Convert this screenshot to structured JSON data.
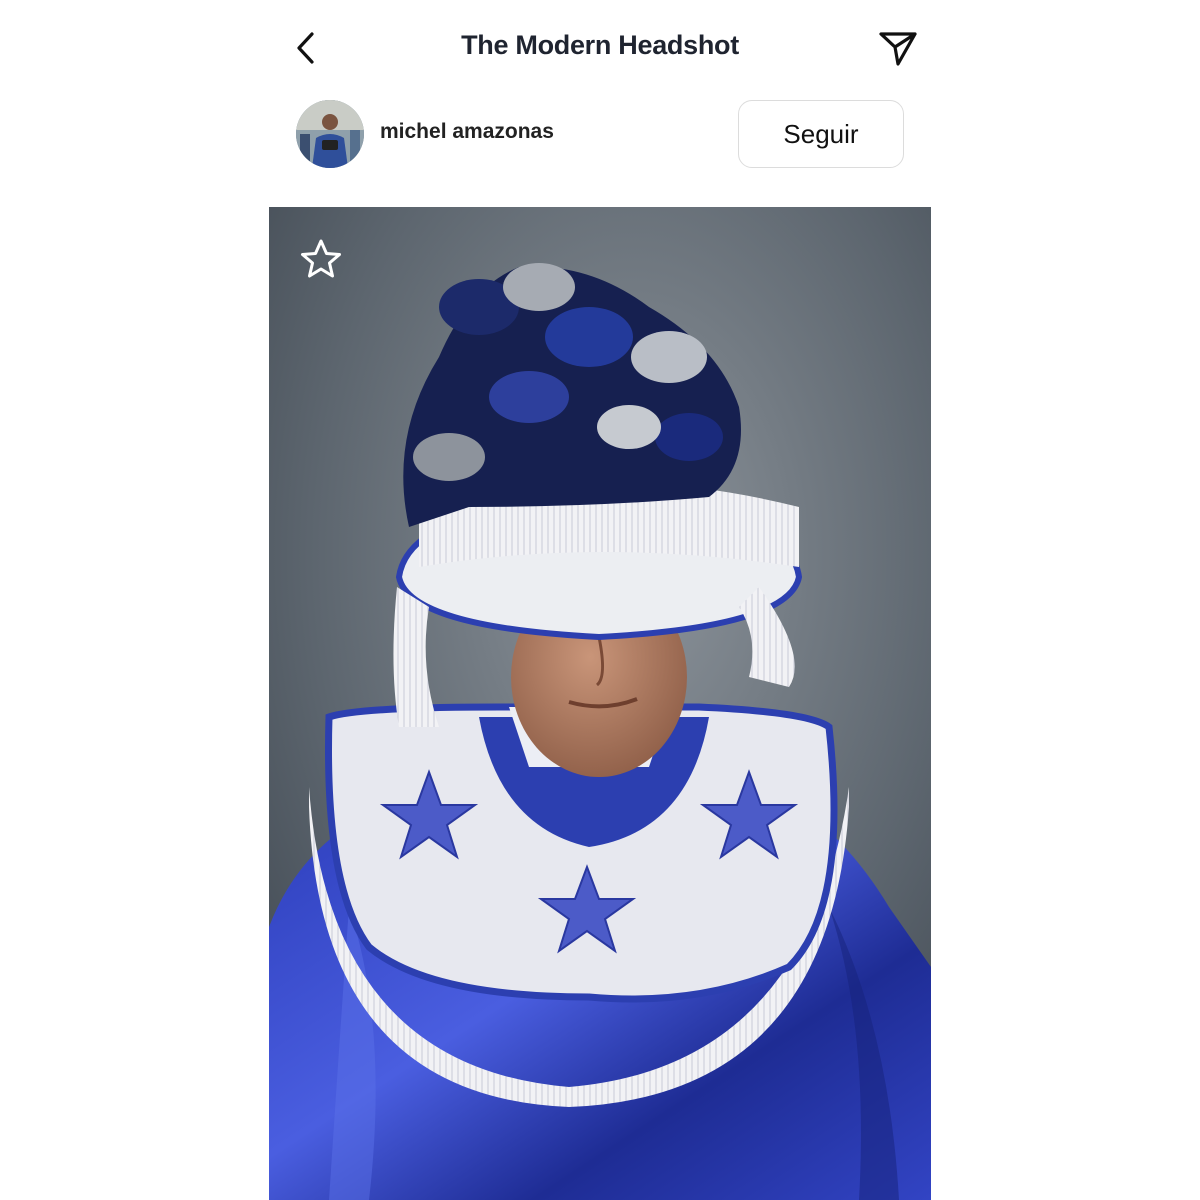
{
  "header": {
    "title": "The Modern Headshot",
    "back_icon": "chevron-left-icon",
    "share_icon": "send-icon"
  },
  "author": {
    "name": "michel amazonas",
    "follow_label": "Seguir"
  },
  "post": {
    "favorite_icon": "star-outline-icon",
    "photo_subject": "portrait"
  },
  "colors": {
    "text_dark": "#1f2430",
    "button_border": "#dcdcdc",
    "costume_blue": "#2c3fb0"
  }
}
